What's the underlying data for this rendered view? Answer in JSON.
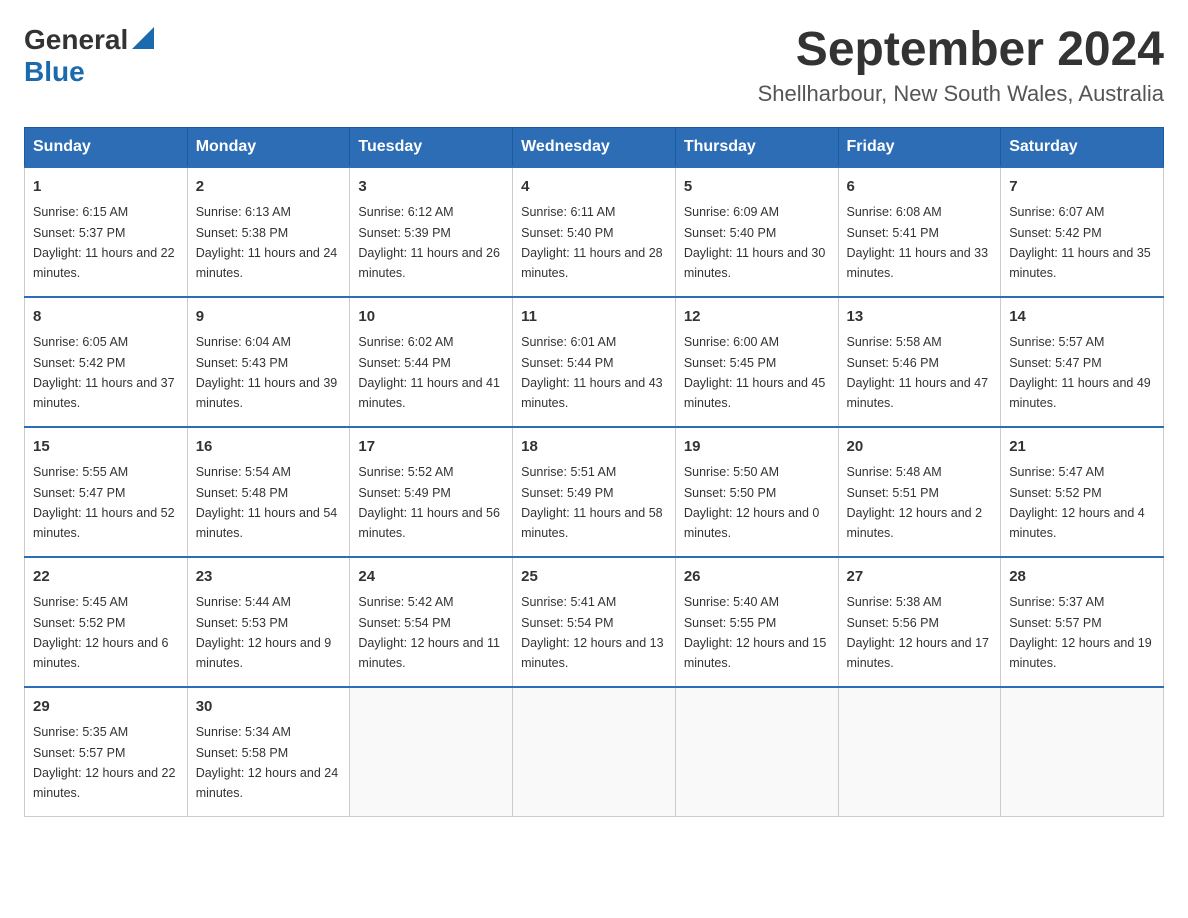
{
  "logo": {
    "general": "General",
    "blue": "Blue"
  },
  "title": "September 2024",
  "location": "Shellharbour, New South Wales, Australia",
  "days_of_week": [
    "Sunday",
    "Monday",
    "Tuesday",
    "Wednesday",
    "Thursday",
    "Friday",
    "Saturday"
  ],
  "weeks": [
    [
      {
        "day": "1",
        "sunrise": "6:15 AM",
        "sunset": "5:37 PM",
        "daylight": "11 hours and 22 minutes."
      },
      {
        "day": "2",
        "sunrise": "6:13 AM",
        "sunset": "5:38 PM",
        "daylight": "11 hours and 24 minutes."
      },
      {
        "day": "3",
        "sunrise": "6:12 AM",
        "sunset": "5:39 PM",
        "daylight": "11 hours and 26 minutes."
      },
      {
        "day": "4",
        "sunrise": "6:11 AM",
        "sunset": "5:40 PM",
        "daylight": "11 hours and 28 minutes."
      },
      {
        "day": "5",
        "sunrise": "6:09 AM",
        "sunset": "5:40 PM",
        "daylight": "11 hours and 30 minutes."
      },
      {
        "day": "6",
        "sunrise": "6:08 AM",
        "sunset": "5:41 PM",
        "daylight": "11 hours and 33 minutes."
      },
      {
        "day": "7",
        "sunrise": "6:07 AM",
        "sunset": "5:42 PM",
        "daylight": "11 hours and 35 minutes."
      }
    ],
    [
      {
        "day": "8",
        "sunrise": "6:05 AM",
        "sunset": "5:42 PM",
        "daylight": "11 hours and 37 minutes."
      },
      {
        "day": "9",
        "sunrise": "6:04 AM",
        "sunset": "5:43 PM",
        "daylight": "11 hours and 39 minutes."
      },
      {
        "day": "10",
        "sunrise": "6:02 AM",
        "sunset": "5:44 PM",
        "daylight": "11 hours and 41 minutes."
      },
      {
        "day": "11",
        "sunrise": "6:01 AM",
        "sunset": "5:44 PM",
        "daylight": "11 hours and 43 minutes."
      },
      {
        "day": "12",
        "sunrise": "6:00 AM",
        "sunset": "5:45 PM",
        "daylight": "11 hours and 45 minutes."
      },
      {
        "day": "13",
        "sunrise": "5:58 AM",
        "sunset": "5:46 PM",
        "daylight": "11 hours and 47 minutes."
      },
      {
        "day": "14",
        "sunrise": "5:57 AM",
        "sunset": "5:47 PM",
        "daylight": "11 hours and 49 minutes."
      }
    ],
    [
      {
        "day": "15",
        "sunrise": "5:55 AM",
        "sunset": "5:47 PM",
        "daylight": "11 hours and 52 minutes."
      },
      {
        "day": "16",
        "sunrise": "5:54 AM",
        "sunset": "5:48 PM",
        "daylight": "11 hours and 54 minutes."
      },
      {
        "day": "17",
        "sunrise": "5:52 AM",
        "sunset": "5:49 PM",
        "daylight": "11 hours and 56 minutes."
      },
      {
        "day": "18",
        "sunrise": "5:51 AM",
        "sunset": "5:49 PM",
        "daylight": "11 hours and 58 minutes."
      },
      {
        "day": "19",
        "sunrise": "5:50 AM",
        "sunset": "5:50 PM",
        "daylight": "12 hours and 0 minutes."
      },
      {
        "day": "20",
        "sunrise": "5:48 AM",
        "sunset": "5:51 PM",
        "daylight": "12 hours and 2 minutes."
      },
      {
        "day": "21",
        "sunrise": "5:47 AM",
        "sunset": "5:52 PM",
        "daylight": "12 hours and 4 minutes."
      }
    ],
    [
      {
        "day": "22",
        "sunrise": "5:45 AM",
        "sunset": "5:52 PM",
        "daylight": "12 hours and 6 minutes."
      },
      {
        "day": "23",
        "sunrise": "5:44 AM",
        "sunset": "5:53 PM",
        "daylight": "12 hours and 9 minutes."
      },
      {
        "day": "24",
        "sunrise": "5:42 AM",
        "sunset": "5:54 PM",
        "daylight": "12 hours and 11 minutes."
      },
      {
        "day": "25",
        "sunrise": "5:41 AM",
        "sunset": "5:54 PM",
        "daylight": "12 hours and 13 minutes."
      },
      {
        "day": "26",
        "sunrise": "5:40 AM",
        "sunset": "5:55 PM",
        "daylight": "12 hours and 15 minutes."
      },
      {
        "day": "27",
        "sunrise": "5:38 AM",
        "sunset": "5:56 PM",
        "daylight": "12 hours and 17 minutes."
      },
      {
        "day": "28",
        "sunrise": "5:37 AM",
        "sunset": "5:57 PM",
        "daylight": "12 hours and 19 minutes."
      }
    ],
    [
      {
        "day": "29",
        "sunrise": "5:35 AM",
        "sunset": "5:57 PM",
        "daylight": "12 hours and 22 minutes."
      },
      {
        "day": "30",
        "sunrise": "5:34 AM",
        "sunset": "5:58 PM",
        "daylight": "12 hours and 24 minutes."
      },
      null,
      null,
      null,
      null,
      null
    ]
  ]
}
